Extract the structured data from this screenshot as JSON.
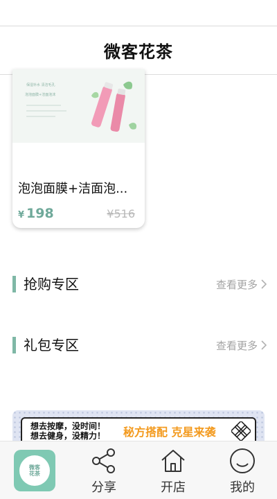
{
  "header": {
    "title": "微客花茶"
  },
  "product": {
    "image_caption_1": "保湿补水 清洁毛孔",
    "image_caption_2": "泡泡面膜+洁面泡沫",
    "name": "泡泡面膜+洁面泡...",
    "currency": "¥",
    "price": "198",
    "original_price": "¥516"
  },
  "sections": [
    {
      "title": "抢购专区",
      "more_label": "查看更多"
    },
    {
      "title": "礼包专区",
      "more_label": "查看更多"
    }
  ],
  "banner": {
    "line1": "想去按摩，没时间！",
    "line2": "想去健身，没精力！",
    "slogan": "秘方搭配 克星来袭"
  },
  "tab_bar": {
    "home_logo_text_1": "微客",
    "home_logo_text_2": "花茶",
    "items": [
      {
        "label": "分享",
        "icon": "share-icon"
      },
      {
        "label": "开店",
        "icon": "store-icon"
      },
      {
        "label": "我的",
        "icon": "profile-icon"
      }
    ]
  },
  "colors": {
    "accent": "#7fb8a6",
    "price": "#6fa99a",
    "banner_slogan": "#f39a1e"
  }
}
